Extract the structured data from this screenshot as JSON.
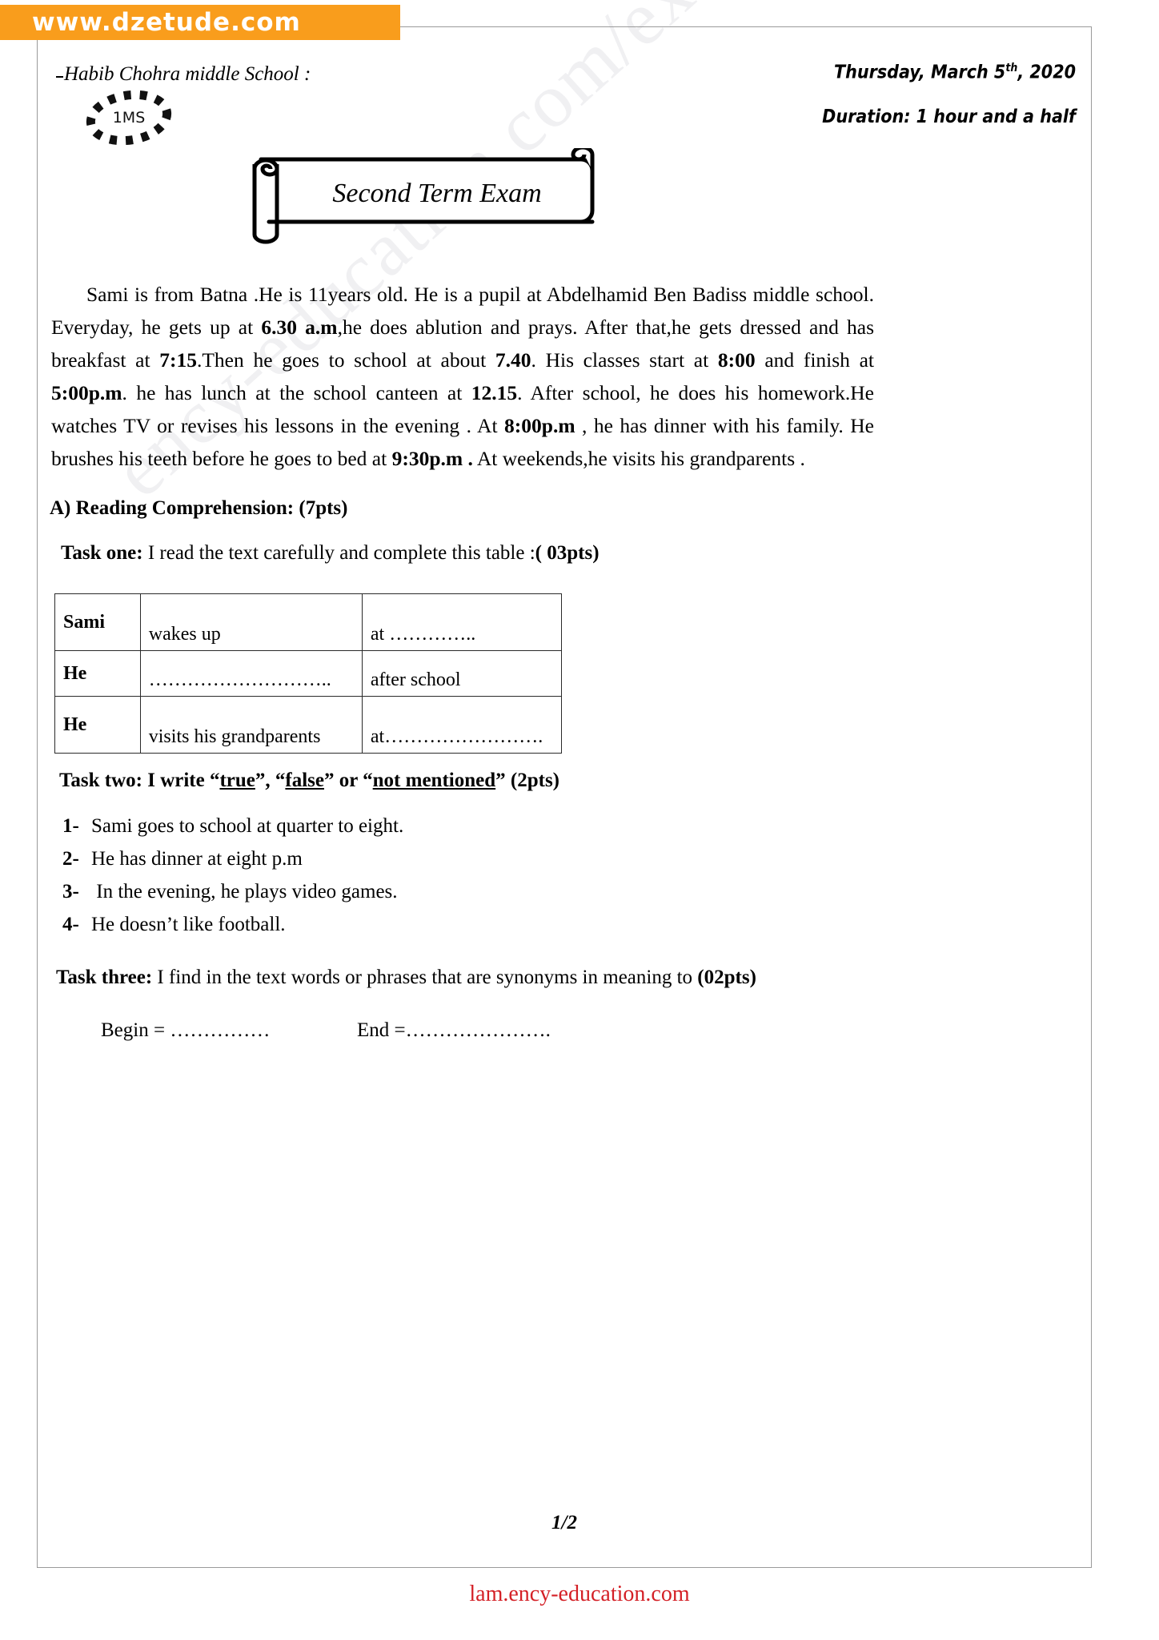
{
  "site_banner": {
    "text": "www.dzetude.com",
    "background_color": "#f99d1c",
    "text_color": "#ffffff"
  },
  "header": {
    "school": "Habib Chohra  middle School :",
    "stamp_label": "1MS",
    "date": "Thursday, March 5",
    "date_sup": "th",
    "date_tail": ", 2020",
    "duration": "Duration: 1 hour and a half"
  },
  "title": "Second Term Exam",
  "passage": {
    "segments": [
      {
        "t": "Sami is from Batna .He is 11years old. He is a pupil at Abdelhamid Ben Badiss middle school. Everyday, he gets up at ",
        "b": false
      },
      {
        "t": "6.30 a.m",
        "b": true
      },
      {
        "t": ",he does ablution and prays. After that,he gets dressed and has breakfast  at ",
        "b": false
      },
      {
        "t": "7:15",
        "b": true
      },
      {
        "t": ".Then he  goes to school at about ",
        "b": false
      },
      {
        "t": "7.40",
        "b": true
      },
      {
        "t": ". His classes start at ",
        "b": false
      },
      {
        "t": "8:00",
        "b": true
      },
      {
        "t": " and finish at ",
        "b": false
      },
      {
        "t": "5:00p.m",
        "b": true
      },
      {
        "t": ". he has lunch at the school canteen at ",
        "b": false
      },
      {
        "t": "12.15",
        "b": true
      },
      {
        "t": ". After school, he does his homework.He watches TV or revises his lessons in the evening . At ",
        "b": false
      },
      {
        "t": "8:00p.m ",
        "b": true
      },
      {
        "t": ", he has dinner with his family. He brushes his teeth before he goes to bed at ",
        "b": false
      },
      {
        "t": "9:30p.m .",
        "b": true
      },
      {
        "t": " At weekends,he visits his grandparents .",
        "b": false
      }
    ]
  },
  "section_a": "A) Reading Comprehension: (7pts)",
  "task_one": {
    "label": "Task one:",
    "instruction": " I read the text carefully and complete this table :",
    "points": "( 03pts)"
  },
  "table": {
    "rows": [
      {
        "subject": "Sami",
        "verb": "wakes up",
        "when": "at ………….."
      },
      {
        "subject": "He",
        "verb": "………………………..",
        "when": "after school"
      },
      {
        "subject": "He",
        "verb": "visits his grandparents",
        "when": "at……………………."
      }
    ]
  },
  "task_two": {
    "label": "Task two:",
    "pre": " I write ",
    "opt1": "true",
    "opt2": "false",
    "opt3": "not mentioned",
    "points": " (2pts)",
    "items": [
      {
        "num": "1-",
        "text": "Sami goes to school at quarter to eight."
      },
      {
        "num": "2-",
        "text": "He has dinner at eight p.m"
      },
      {
        "num": "3-",
        "text": " In the evening, he plays video games."
      },
      {
        "num": "4-",
        "text": "He doesn’t like football."
      }
    ]
  },
  "task_three": {
    "label": "Task three:",
    "instruction": " I find in the text words or phrases that are synonyms in meaning to ",
    "points": "(02pts)",
    "begin": "Begin = ……………",
    "end": "End =…………………."
  },
  "footer": {
    "page_number": "1/2",
    "url": "lam.ency-education.com",
    "url_color": "#d42026"
  },
  "watermark": {
    "lines": [
      "ency-education.com/exams"
    ]
  }
}
